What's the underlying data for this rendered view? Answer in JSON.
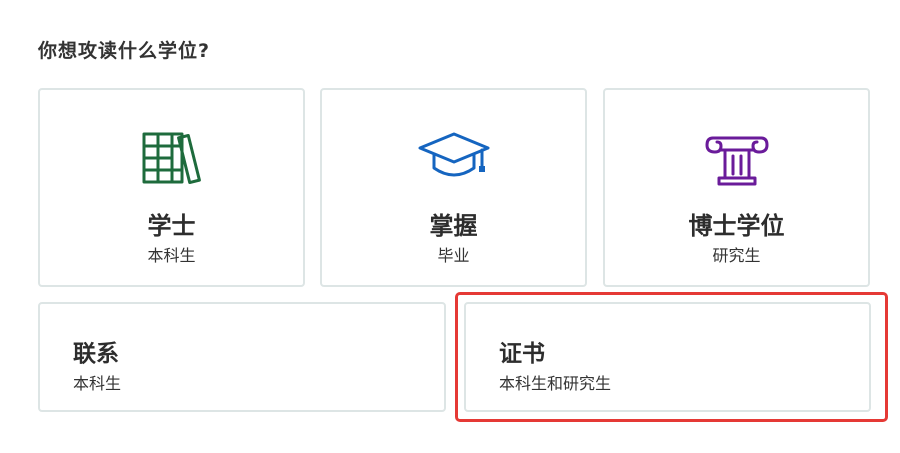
{
  "question": "你想攻读什么学位?",
  "cards": [
    {
      "title": "学士",
      "subtitle": "本科生",
      "icon": "books-icon",
      "icon_color": "#1e6b3c"
    },
    {
      "title": "掌握",
      "subtitle": "毕业",
      "icon": "graduation-cap-icon",
      "icon_color": "#1565c0"
    },
    {
      "title": "博士学位",
      "subtitle": "研究生",
      "icon": "column-icon",
      "icon_color": "#6a1b9a"
    },
    {
      "title": "联系",
      "subtitle": "本科生"
    },
    {
      "title": "证书",
      "subtitle": "本科生和研究生"
    }
  ],
  "highlight_color": "#e53935"
}
